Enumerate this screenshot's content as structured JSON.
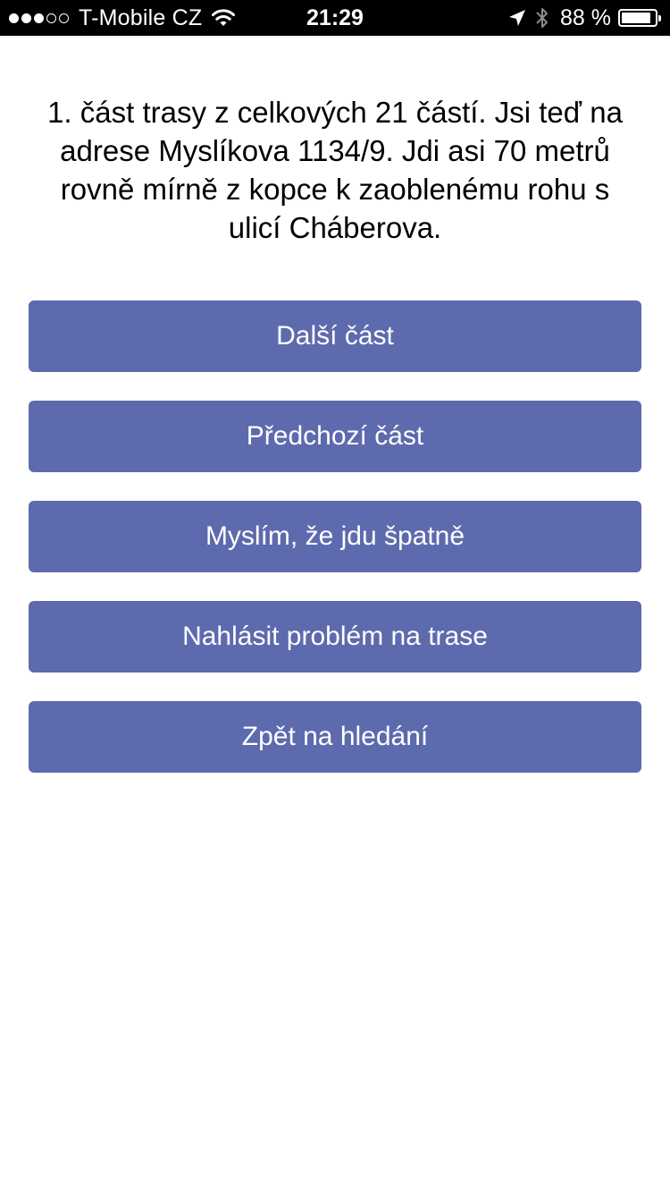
{
  "status_bar": {
    "signal_dots": 5,
    "signal_filled": 3,
    "carrier": "T-Mobile CZ",
    "time": "21:29",
    "battery_percent": "88 %",
    "battery_level": 0.88,
    "icons": [
      "wifi-icon",
      "location-arrow-icon",
      "bluetooth-icon",
      "battery-icon"
    ]
  },
  "main": {
    "instruction": "1. část trasy z celkových 21 částí. Jsi teď na adrese Myslíkova 1134/9. Jdi asi 70 metrů rovně mírně z kopce k zaoblenému rohu s ulicí Cháberova.",
    "buttons": [
      {
        "label": "Další část"
      },
      {
        "label": "Předchozí část"
      },
      {
        "label": "Myslím, že jdu špatně"
      },
      {
        "label": "Nahlásit problém na trase"
      },
      {
        "label": "Zpět na hledání"
      }
    ]
  },
  "colors": {
    "button_bg": "#5d6aad",
    "button_text": "#ffffff",
    "status_bar_bg": "#000000",
    "background": "#ffffff"
  }
}
